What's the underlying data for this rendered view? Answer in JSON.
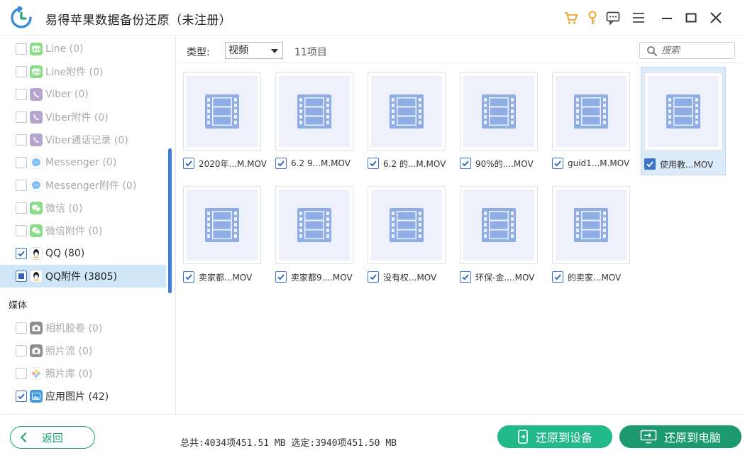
{
  "app": {
    "title": "易得苹果数据备份还原（未注册）"
  },
  "colors": {
    "accent_green": "#22b98a",
    "accent_dark_green": "#1c9a6f",
    "selection_blue": "#cfe5f8",
    "cart_icon": "#f0a020"
  },
  "titlebar": {
    "icons": [
      "cart-icon",
      "key-icon",
      "feedback-icon",
      "menu-icon",
      "minimize-icon",
      "maximize-icon",
      "close-icon"
    ]
  },
  "sidebar": {
    "items": [
      {
        "label": "Line (0)",
        "icon": "line-icon",
        "state": "unchecked",
        "active": false
      },
      {
        "label": "Line附件 (0)",
        "icon": "line-icon",
        "state": "unchecked",
        "active": false
      },
      {
        "label": "Viber (0)",
        "icon": "viber-icon",
        "state": "unchecked",
        "active": false
      },
      {
        "label": "Viber附件 (0)",
        "icon": "viber-icon",
        "state": "unchecked",
        "active": false
      },
      {
        "label": "Viber通话记录 (0)",
        "icon": "viber-icon",
        "state": "unchecked",
        "active": false
      },
      {
        "label": "Messenger (0)",
        "icon": "messenger-icon",
        "state": "unchecked",
        "active": false
      },
      {
        "label": "Messenger附件 (0)",
        "icon": "messenger-icon",
        "state": "unchecked",
        "active": false
      },
      {
        "label": "微信 (0)",
        "icon": "wechat-icon",
        "state": "unchecked",
        "active": false
      },
      {
        "label": "微信附件 (0)",
        "icon": "wechat-icon",
        "state": "unchecked",
        "active": false
      },
      {
        "label": "QQ (80)",
        "icon": "qq-icon",
        "state": "checked",
        "active": true
      },
      {
        "label": "QQ附件 (3805)",
        "icon": "qq-icon",
        "state": "partial",
        "active": true,
        "selected": true
      }
    ],
    "media_section": "媒体",
    "media_items": [
      {
        "label": "相机胶卷 (0)",
        "icon": "camera-icon",
        "state": "unchecked",
        "active": false
      },
      {
        "label": "照片流 (0)",
        "icon": "camera-icon",
        "state": "unchecked",
        "active": false
      },
      {
        "label": "照片库 (0)",
        "icon": "photos-icon",
        "state": "unchecked",
        "active": false
      },
      {
        "label": "应用图片 (42)",
        "icon": "app-image-icon",
        "state": "checked",
        "active": true
      }
    ]
  },
  "toolbar": {
    "type_label": "类型:",
    "type_selected": "视频",
    "item_count": "11项目",
    "search_placeholder": "搜索"
  },
  "files": [
    {
      "name": "2020年...M.MOV",
      "checked": true,
      "selected": false
    },
    {
      "name": "6.2 9...M.MOV",
      "checked": true,
      "selected": false
    },
    {
      "name": "6.2 的...M.MOV",
      "checked": true,
      "selected": false
    },
    {
      "name": "90%的....MOV",
      "checked": true,
      "selected": false
    },
    {
      "name": "guid1...M.MOV",
      "checked": true,
      "selected": false
    },
    {
      "name": "使用教...MOV",
      "checked": true,
      "selected": true
    },
    {
      "name": "卖家都...MOV",
      "checked": true,
      "selected": false
    },
    {
      "name": "卖家都9....MOV",
      "checked": true,
      "selected": false
    },
    {
      "name": "没有权...MOV",
      "checked": true,
      "selected": false
    },
    {
      "name": "环保-金....MOV",
      "checked": true,
      "selected": false
    },
    {
      "name": "的卖家...MOV",
      "checked": true,
      "selected": false
    }
  ],
  "footer": {
    "back_label": "返回",
    "totals": "总共:4034项451.51 MB 选定:3940项451.50 MB",
    "restore_device": "还原到设备",
    "restore_pc": "还原到电脑"
  }
}
